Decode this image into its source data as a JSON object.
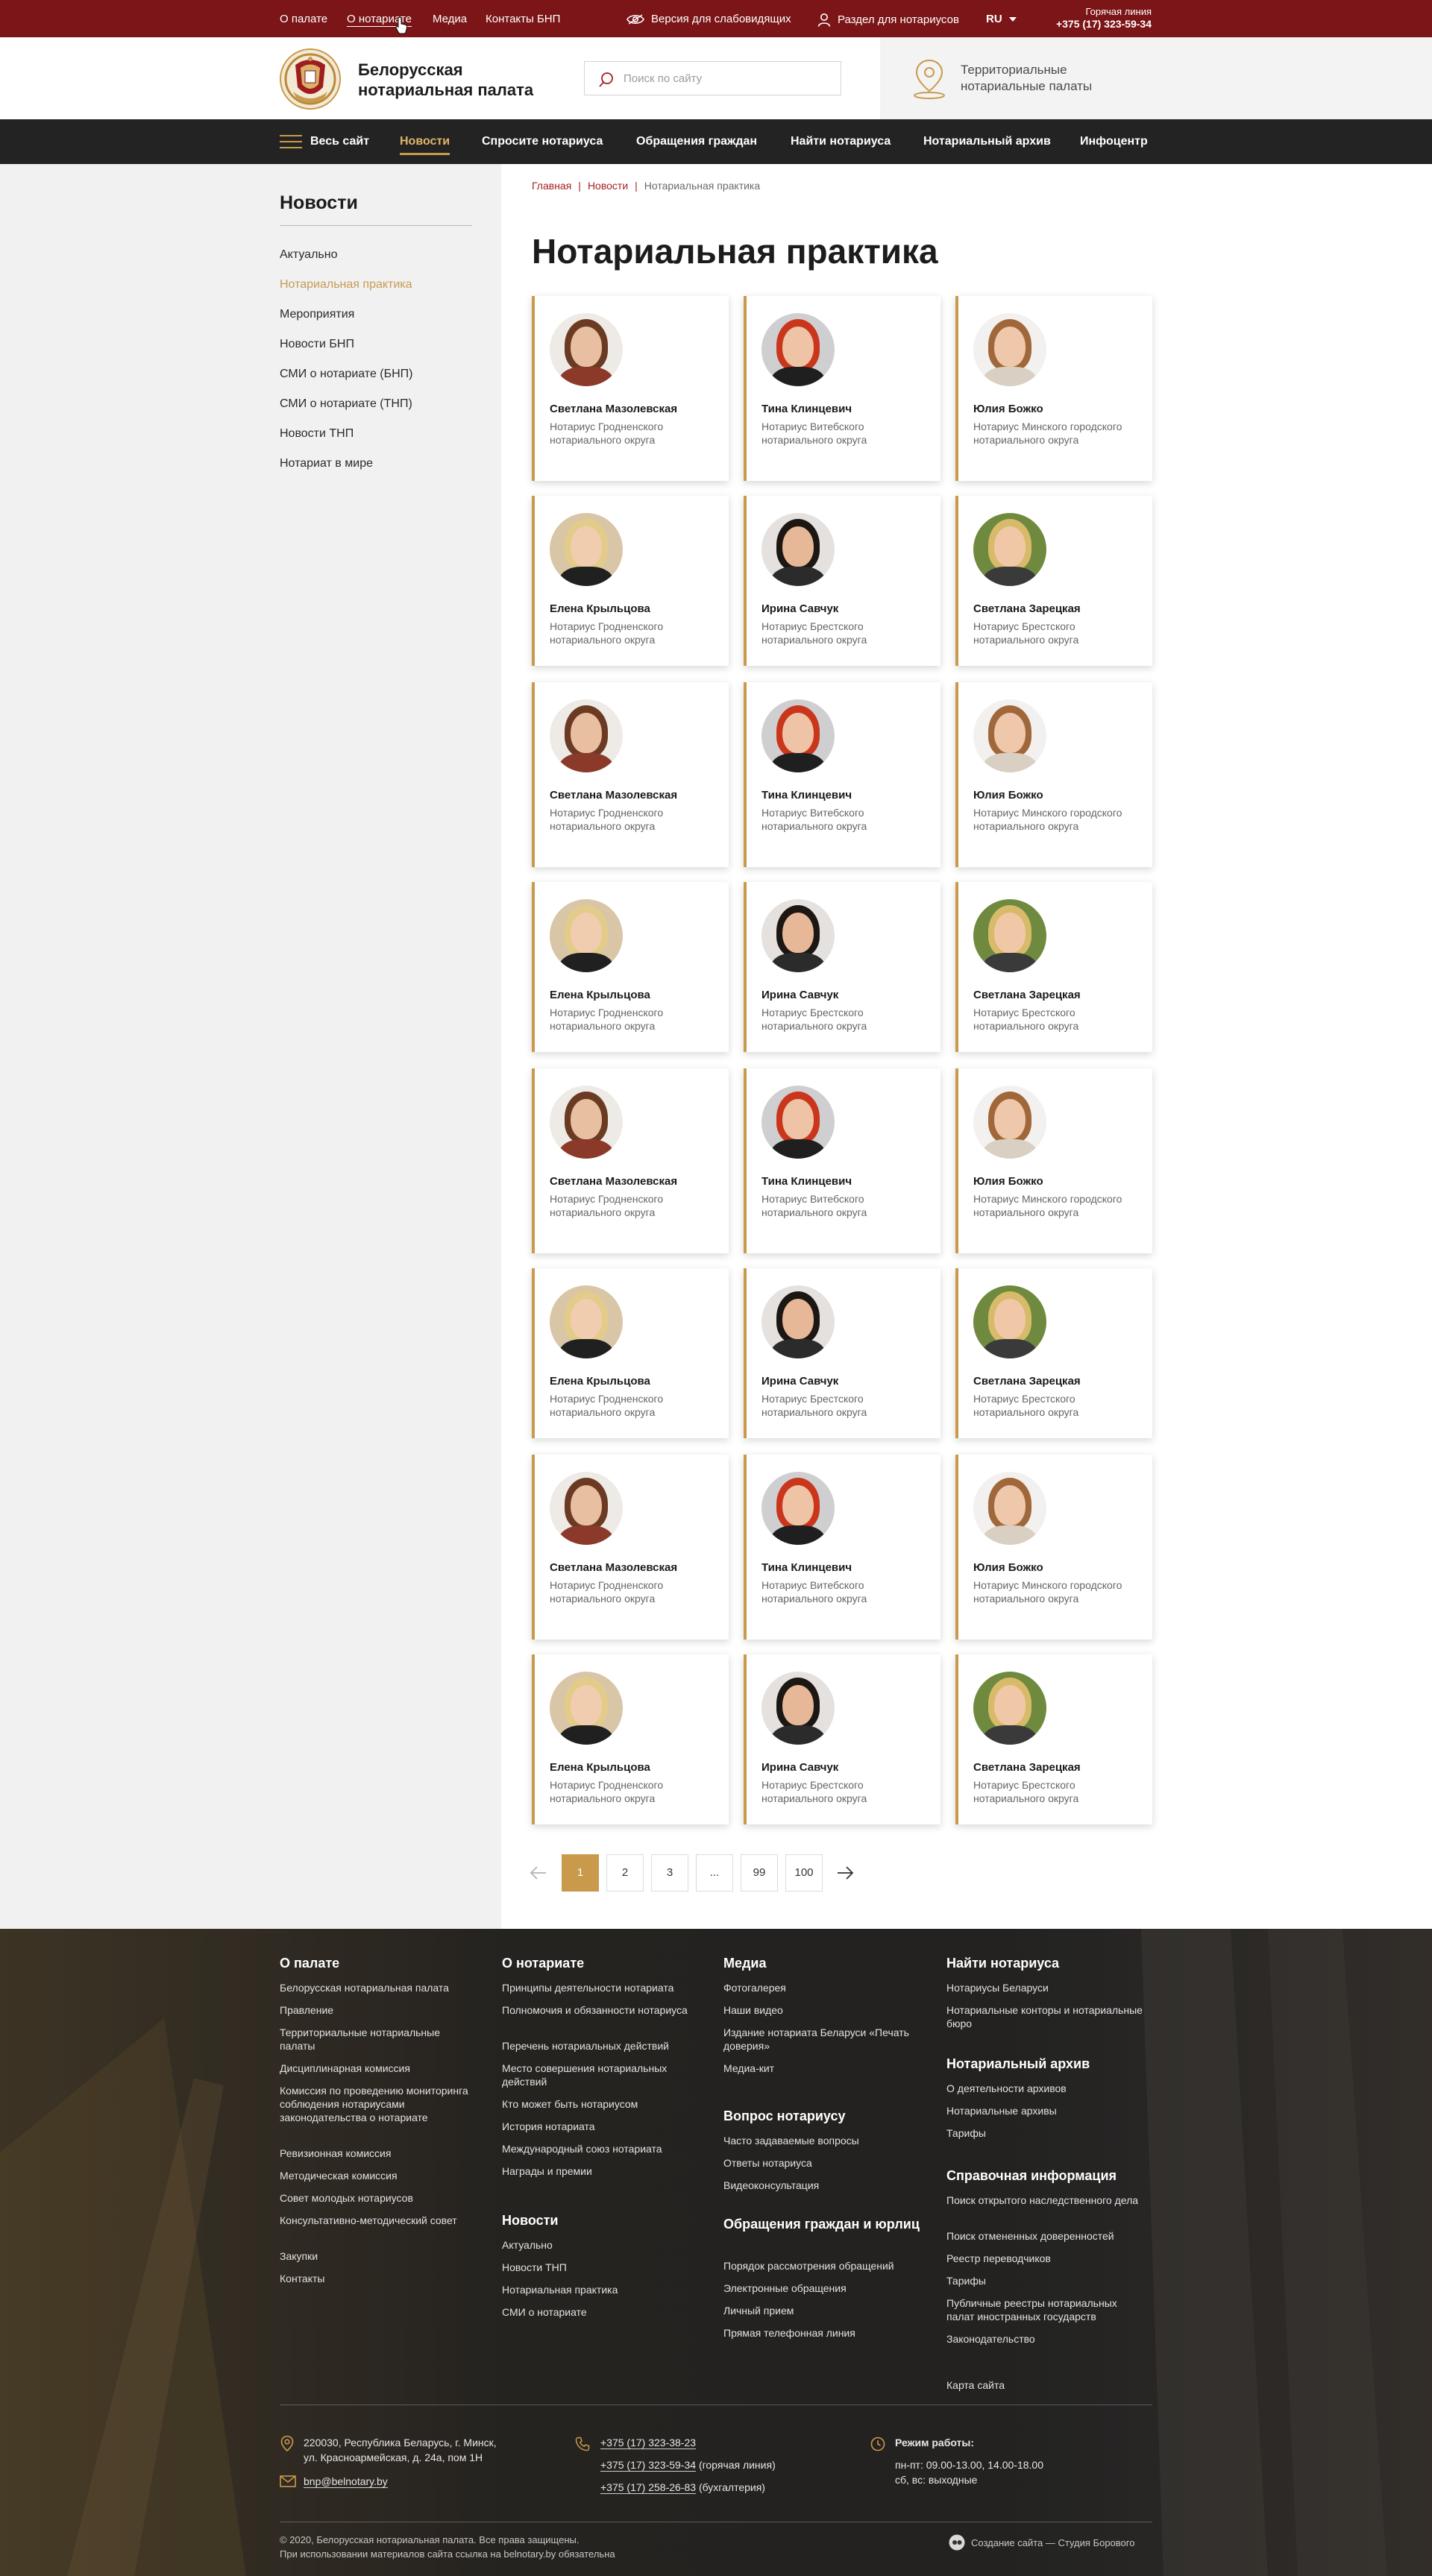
{
  "topbar": {
    "links": [
      "О палате",
      "О нотариате",
      "Медиа",
      "Контакты БНП"
    ],
    "low_vision": "Версия для слабовидящих",
    "notary_section": "Раздел для нотариусов",
    "lang": "RU",
    "hotline_label": "Горячая линия",
    "hotline_phone": "+375 (17) 323-59-34"
  },
  "header": {
    "brand_line1": "Белорусская",
    "brand_line2": "нотариальная палата",
    "search_placeholder": "Поиск по сайту",
    "territorial_line1": "Территориальные",
    "territorial_line2": "нотариальные палаты"
  },
  "nav": {
    "all_site": "Весь сайт",
    "items": [
      "Новости",
      "Спросите нотариуса",
      "Обращения граждан",
      "Найти нотариуса",
      "Нотариальный архив",
      "Инфоцентр"
    ]
  },
  "sidebar": {
    "title": "Новости",
    "items": [
      "Актуально",
      "Нотариальная практика",
      "Мероприятия",
      "Новости БНП",
      "СМИ о нотариате (БНП)",
      "СМИ о нотариате (ТНП)",
      "Новости ТНП",
      "Нотариат в мире"
    ]
  },
  "breadcrumb": [
    "Главная",
    "Новости",
    "Нотариальная практика"
  ],
  "page_title": "Нотариальная практика",
  "cards": [
    {
      "name": "Светлана Мазолевская",
      "role": "Нотариус Гродненского нотариального округа"
    },
    {
      "name": "Тина Клинцевич",
      "role": "Нотариус Витебского нотариального округа"
    },
    {
      "name": "Юлия Божко",
      "role": "Нотариус Минского городского нотариального округа"
    },
    {
      "name": "Елена Крыльцова",
      "role": "Нотариус Гродненского нотариального округа"
    },
    {
      "name": "Ирина Савчук",
      "role": "Нотариус Брестского нотариального округа"
    },
    {
      "name": "Светлана Зарецкая",
      "role": "Нотариус Брестского нотариального округа"
    },
    {
      "name": "Светлана Мазолевская",
      "role": "Нотариус Гродненского нотариального округа"
    },
    {
      "name": "Тина Клинцевич",
      "role": "Нотариус Витебского нотариального округа"
    },
    {
      "name": "Юлия Божко",
      "role": "Нотариус Минского городского нотариального округа"
    },
    {
      "name": "Елена Крыльцова",
      "role": "Нотариус Гродненского нотариального округа"
    },
    {
      "name": "Ирина Савчук",
      "role": "Нотариус Брестского нотариального округа"
    },
    {
      "name": "Светлана Зарецкая",
      "role": "Нотариус Брестского нотариального округа"
    },
    {
      "name": "Светлана Мазолевская",
      "role": "Нотариус Гродненского нотариального округа"
    },
    {
      "name": "Тина Клинцевич",
      "role": "Нотариус Витебского нотариального округа"
    },
    {
      "name": "Юлия Божко",
      "role": "Нотариус Минского городского нотариального округа"
    },
    {
      "name": "Елена Крыльцова",
      "role": "Нотариус Гродненского нотариального округа"
    },
    {
      "name": "Ирина Савчук",
      "role": "Нотариус Брестского нотариального округа"
    },
    {
      "name": "Светлана Зарецкая",
      "role": "Нотариус Брестского нотариального округа"
    },
    {
      "name": "Светлана Мазолевская",
      "role": "Нотариус Гродненского нотариального округа"
    },
    {
      "name": "Тина Клинцевич",
      "role": "Нотариус Витебского нотариального округа"
    },
    {
      "name": "Юлия Божко",
      "role": "Нотариус Минского городского нотариального округа"
    },
    {
      "name": "Елена Крыльцова",
      "role": "Нотариус Гродненского нотариального округа"
    },
    {
      "name": "Ирина Савчук",
      "role": "Нотариус Брестского нотариального округа"
    },
    {
      "name": "Светлана Зарецкая",
      "role": "Нотариус Брестского нотариального округа"
    }
  ],
  "pagination": {
    "pages": [
      "1",
      "2",
      "3",
      "...",
      "99",
      "100"
    ],
    "current": "1"
  },
  "footer": {
    "col1": {
      "title": "О палате",
      "links": [
        "Белорусская нотариальная палата",
        "Правление",
        "Территориальные нотариальные палаты",
        "Дисциплинарная комиссия",
        "Комиссия по проведению мониторинга соблюдения нотариусами законодательства о нотариате",
        "Ревизионная комиссия",
        "Методическая комиссия",
        "Совет молодых нотариусов",
        "Консультативно-методический совет",
        "Закупки",
        "Контакты"
      ]
    },
    "col2": {
      "title": "О нотариате",
      "links": [
        "Принципы деятельности нотариата",
        "Полномочия и обязанности нотариуса",
        "Перечень нотариальных действий",
        "Место совершения нотариальных действий",
        "Кто может быть нотариусом",
        "История нотариата",
        "Международный союз нотариата",
        "Награды и премии"
      ]
    },
    "col2b": {
      "title": "Новости",
      "links": [
        "Актуально",
        "Новости ТНП",
        "Нотариальная практика",
        "СМИ о нотариате"
      ]
    },
    "col3": {
      "title": "Медиа",
      "links": [
        "Фотогалерея",
        "Наши видео",
        "Издание нотариата Беларуси «Печать доверия»",
        "Медиа-кит"
      ]
    },
    "col3b": {
      "title": "Вопрос нотариусу",
      "links": [
        "Часто задаваемые вопросы",
        "Ответы нотариуса",
        "Видеоконсультация"
      ]
    },
    "col3c": {
      "title": "Обращения граждан и юрлиц",
      "links": [
        "Порядок рассмотрения обращений",
        "Электронные обращения",
        "Личный прием",
        "Прямая телефонная линия"
      ]
    },
    "col4": {
      "title": "Найти нотариуса",
      "links": [
        "Нотариусы Беларуси",
        "Нотариальные конторы и нотариальные бюро"
      ]
    },
    "col4b": {
      "title": "Нотариальный архив",
      "links": [
        "О деятельности архивов",
        "Нотариальные архивы",
        "Тарифы"
      ]
    },
    "col4c": {
      "title": "Справочная информация",
      "links": [
        "Поиск открытого наследственного дела",
        "Поиск отмененных доверенностей",
        "Реестр переводчиков",
        "Тарифы",
        "Публичные реестры нотариальных палат иностранных государств",
        "Законодательство"
      ]
    },
    "sitemap": "Карта сайта",
    "address_line1": "220030, Республика Беларусь, г. Минск,",
    "address_line2": "ул. Красноармейская, д. 24а, пом 1Н",
    "email": "bnp@belnotary.by",
    "phone1": "+375 (17) 323-38-23",
    "phone2": "+375 (17) 323-59-34",
    "phone2_note": "(горячая линия)",
    "phone3": "+375 (17) 258-26-83",
    "phone3_note": "(бухгалтерия)",
    "hours_title": "Режим работы:",
    "hours_line1": "пн-пт: 09.00-13.00, 14.00-18.00",
    "hours_line2": "сб, вс: выходные",
    "copyright_line1": "© 2020, Белорусская нотариальная палата. Все права защищены.",
    "copyright_line2": "При использовании материалов сайта ссылка на belnotary.by обязательна",
    "studio": "Создание сайта — Студия Борового"
  },
  "colors": {
    "maroon": "#7b1517",
    "gold": "#c99a4b",
    "nav_bg": "#232323",
    "link_red": "#a61f21"
  }
}
